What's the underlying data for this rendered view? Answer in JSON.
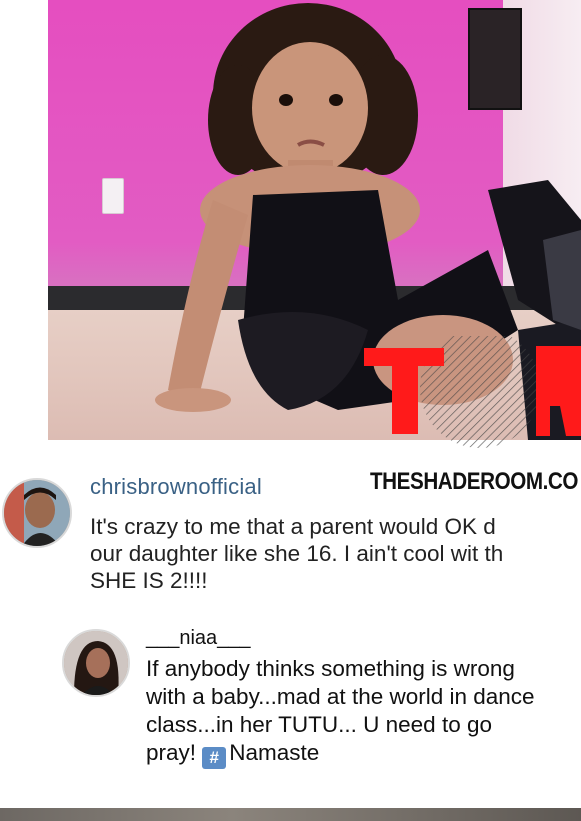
{
  "post": {
    "username": "chrisbrownofficial",
    "caption_lines": [
      "It's crazy to me that a parent would OK d",
      "our daughter like she 16. I ain't cool wit th",
      "SHE IS 2!!!!"
    ]
  },
  "watermark": {
    "site_name": "THESHADEROOM.CO",
    "logo_text": "TSR"
  },
  "reply": {
    "username": "___niaa___",
    "text_lines": [
      "If anybody thinks something is wrong",
      "with a baby...mad at the world in dance",
      "class...in her TUTU... U need to go"
    ],
    "last_line_prefix": "pray! ",
    "hashtag_symbol": "#",
    "hashtag_word": "Namaste"
  },
  "colors": {
    "username_blue": "#3a6185",
    "logo_red": "#ff1a1a",
    "hashtag_blue": "#5b8cc6"
  }
}
